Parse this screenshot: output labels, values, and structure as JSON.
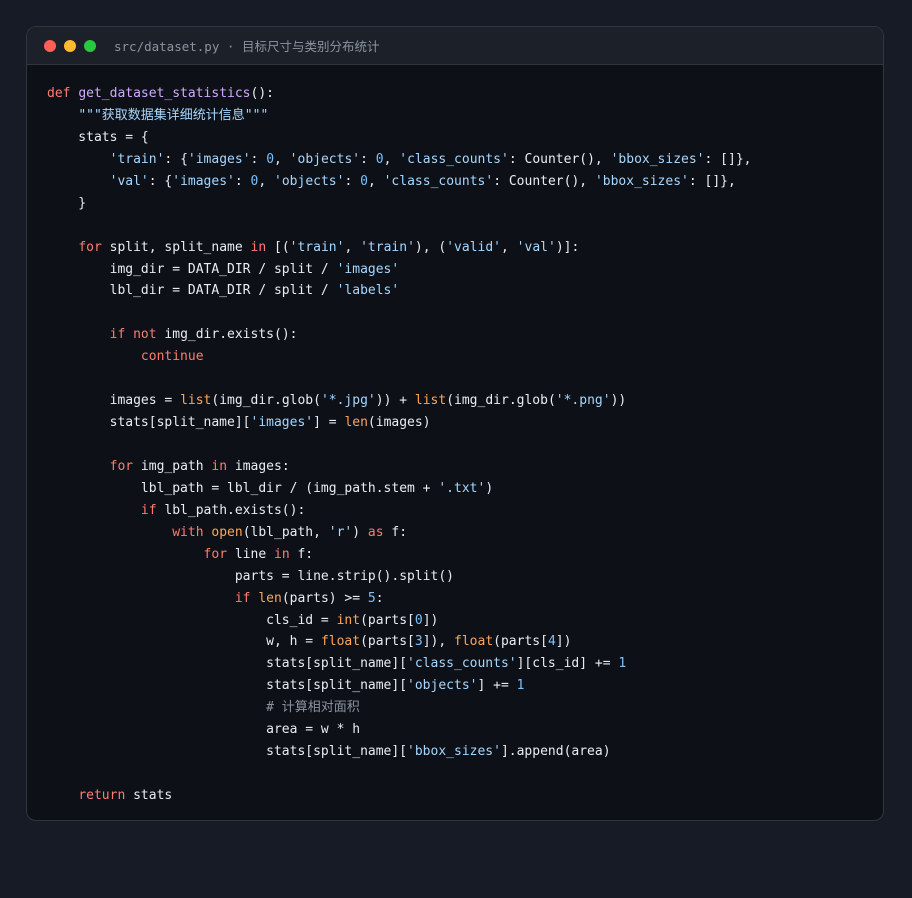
{
  "window": {
    "filename": "src/dataset.py",
    "separator": " · ",
    "subtitle": "目标尺寸与类别分布统计"
  },
  "colors": {
    "keyword": "#ff7b72",
    "function": "#d2a8ff",
    "builtin": "#ffa657",
    "string": "#a5d6ff",
    "number": "#79c0ff",
    "comment": "#8b949e",
    "plain": "#e6edf3",
    "background": "#0d1117",
    "titlebar": "#1c2129"
  },
  "code": {
    "lines": [
      [
        {
          "t": "def",
          "c": "kw"
        },
        {
          "t": " "
        },
        {
          "t": "get_dataset_statistics",
          "c": "fn"
        },
        {
          "t": "():"
        }
      ],
      [
        {
          "t": "    "
        },
        {
          "t": "\"\"\"获取数据集详细统计信息\"\"\"",
          "c": "str"
        }
      ],
      [
        {
          "t": "    stats = {"
        }
      ],
      [
        {
          "t": "        "
        },
        {
          "t": "'train'",
          "c": "str"
        },
        {
          "t": ": {"
        },
        {
          "t": "'images'",
          "c": "str"
        },
        {
          "t": ": "
        },
        {
          "t": "0",
          "c": "num"
        },
        {
          "t": ", "
        },
        {
          "t": "'objects'",
          "c": "str"
        },
        {
          "t": ": "
        },
        {
          "t": "0",
          "c": "num"
        },
        {
          "t": ", "
        },
        {
          "t": "'class_counts'",
          "c": "str"
        },
        {
          "t": ": Counter(), "
        },
        {
          "t": "'bbox_sizes'",
          "c": "str"
        },
        {
          "t": ": []},"
        }
      ],
      [
        {
          "t": "        "
        },
        {
          "t": "'val'",
          "c": "str"
        },
        {
          "t": ": {"
        },
        {
          "t": "'images'",
          "c": "str"
        },
        {
          "t": ": "
        },
        {
          "t": "0",
          "c": "num"
        },
        {
          "t": ", "
        },
        {
          "t": "'objects'",
          "c": "str"
        },
        {
          "t": ": "
        },
        {
          "t": "0",
          "c": "num"
        },
        {
          "t": ", "
        },
        {
          "t": "'class_counts'",
          "c": "str"
        },
        {
          "t": ": Counter(), "
        },
        {
          "t": "'bbox_sizes'",
          "c": "str"
        },
        {
          "t": ": []},"
        }
      ],
      [
        {
          "t": "    }"
        }
      ],
      [
        {
          "t": ""
        }
      ],
      [
        {
          "t": "    "
        },
        {
          "t": "for",
          "c": "kw"
        },
        {
          "t": " split, split_name "
        },
        {
          "t": "in",
          "c": "kw"
        },
        {
          "t": " [("
        },
        {
          "t": "'train'",
          "c": "str"
        },
        {
          "t": ", "
        },
        {
          "t": "'train'",
          "c": "str"
        },
        {
          "t": "), ("
        },
        {
          "t": "'valid'",
          "c": "str"
        },
        {
          "t": ", "
        },
        {
          "t": "'val'",
          "c": "str"
        },
        {
          "t": ")]:"
        }
      ],
      [
        {
          "t": "        img_dir = DATA_DIR / split / "
        },
        {
          "t": "'images'",
          "c": "str"
        }
      ],
      [
        {
          "t": "        lbl_dir = DATA_DIR / split / "
        },
        {
          "t": "'labels'",
          "c": "str"
        }
      ],
      [
        {
          "t": ""
        }
      ],
      [
        {
          "t": "        "
        },
        {
          "t": "if",
          "c": "kw"
        },
        {
          "t": " "
        },
        {
          "t": "not",
          "c": "kw"
        },
        {
          "t": " img_dir.exists():"
        }
      ],
      [
        {
          "t": "            "
        },
        {
          "t": "continue",
          "c": "kw"
        }
      ],
      [
        {
          "t": ""
        }
      ],
      [
        {
          "t": "        images = "
        },
        {
          "t": "list",
          "c": "bi"
        },
        {
          "t": "(img_dir.glob("
        },
        {
          "t": "'*.jpg'",
          "c": "str"
        },
        {
          "t": ")) + "
        },
        {
          "t": "list",
          "c": "bi"
        },
        {
          "t": "(img_dir.glob("
        },
        {
          "t": "'*.png'",
          "c": "str"
        },
        {
          "t": "))"
        }
      ],
      [
        {
          "t": "        stats[split_name]["
        },
        {
          "t": "'images'",
          "c": "str"
        },
        {
          "t": "] = "
        },
        {
          "t": "len",
          "c": "bi"
        },
        {
          "t": "(images)"
        }
      ],
      [
        {
          "t": ""
        }
      ],
      [
        {
          "t": "        "
        },
        {
          "t": "for",
          "c": "kw"
        },
        {
          "t": " img_path "
        },
        {
          "t": "in",
          "c": "kw"
        },
        {
          "t": " images:"
        }
      ],
      [
        {
          "t": "            lbl_path = lbl_dir / (img_path.stem + "
        },
        {
          "t": "'.txt'",
          "c": "str"
        },
        {
          "t": ")"
        }
      ],
      [
        {
          "t": "            "
        },
        {
          "t": "if",
          "c": "kw"
        },
        {
          "t": " lbl_path.exists():"
        }
      ],
      [
        {
          "t": "                "
        },
        {
          "t": "with",
          "c": "kw"
        },
        {
          "t": " "
        },
        {
          "t": "open",
          "c": "bi"
        },
        {
          "t": "(lbl_path, "
        },
        {
          "t": "'r'",
          "c": "str"
        },
        {
          "t": ") "
        },
        {
          "t": "as",
          "c": "kw"
        },
        {
          "t": " f:"
        }
      ],
      [
        {
          "t": "                    "
        },
        {
          "t": "for",
          "c": "kw"
        },
        {
          "t": " line "
        },
        {
          "t": "in",
          "c": "kw"
        },
        {
          "t": " f:"
        }
      ],
      [
        {
          "t": "                        parts = line.strip().split()"
        }
      ],
      [
        {
          "t": "                        "
        },
        {
          "t": "if",
          "c": "kw"
        },
        {
          "t": " "
        },
        {
          "t": "len",
          "c": "bi"
        },
        {
          "t": "(parts) >= "
        },
        {
          "t": "5",
          "c": "num"
        },
        {
          "t": ":"
        }
      ],
      [
        {
          "t": "                            cls_id = "
        },
        {
          "t": "int",
          "c": "bi"
        },
        {
          "t": "(parts["
        },
        {
          "t": "0",
          "c": "num"
        },
        {
          "t": "])"
        }
      ],
      [
        {
          "t": "                            w, h = "
        },
        {
          "t": "float",
          "c": "bi"
        },
        {
          "t": "(parts["
        },
        {
          "t": "3",
          "c": "num"
        },
        {
          "t": "]), "
        },
        {
          "t": "float",
          "c": "bi"
        },
        {
          "t": "(parts["
        },
        {
          "t": "4",
          "c": "num"
        },
        {
          "t": "])"
        }
      ],
      [
        {
          "t": "                            stats[split_name]["
        },
        {
          "t": "'class_counts'",
          "c": "str"
        },
        {
          "t": "][cls_id] += "
        },
        {
          "t": "1",
          "c": "num"
        }
      ],
      [
        {
          "t": "                            stats[split_name]["
        },
        {
          "t": "'objects'",
          "c": "str"
        },
        {
          "t": "] += "
        },
        {
          "t": "1",
          "c": "num"
        }
      ],
      [
        {
          "t": "                            "
        },
        {
          "t": "# 计算相对面积",
          "c": "cm"
        }
      ],
      [
        {
          "t": "                            area = w * h"
        }
      ],
      [
        {
          "t": "                            stats[split_name]["
        },
        {
          "t": "'bbox_sizes'",
          "c": "str"
        },
        {
          "t": "].append(area)"
        }
      ],
      [
        {
          "t": ""
        }
      ],
      [
        {
          "t": "    "
        },
        {
          "t": "return",
          "c": "kw"
        },
        {
          "t": " stats"
        }
      ]
    ]
  }
}
